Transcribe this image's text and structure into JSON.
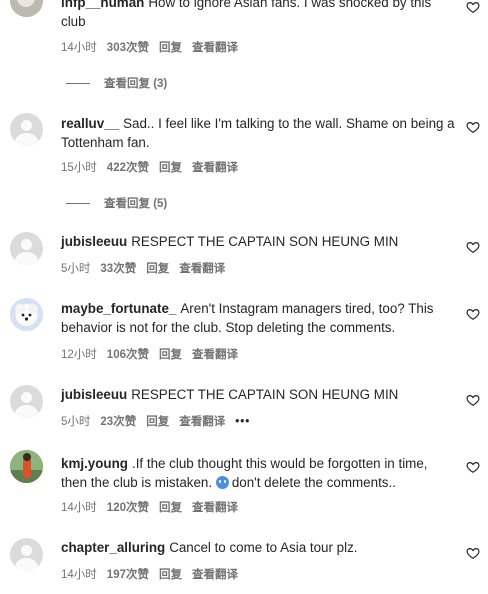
{
  "comments": [
    {
      "username": "infp__human",
      "text": "How to ignore Asian fans. I was shocked by this club",
      "time": "14小时",
      "likes": "303次赞",
      "reply": "回复",
      "translate": "查看翻译",
      "view_replies": "查看回复 (3)"
    },
    {
      "username": "realluv__",
      "text": "Sad.. I feel like I'm talking to the wall. Shame on being a Tottenham fan.",
      "time": "15小时",
      "likes": "422次赞",
      "reply": "回复",
      "translate": "查看翻译",
      "view_replies": "查看回复 (5)"
    },
    {
      "username": "jubisleeuu",
      "text": "RESPECT THE CAPTAIN SON HEUNG MIN",
      "time": "5小时",
      "likes": "33次赞",
      "reply": "回复",
      "translate": "查看翻译"
    },
    {
      "username": "maybe_fortunate_",
      "text": "Aren't Instagram managers tired, too? This behavior is not for the club. Stop deleting the comments.",
      "time": "12小时",
      "likes": "106次赞",
      "reply": "回复",
      "translate": "查看翻译"
    },
    {
      "username": "jubisleeuu",
      "text": "RESPECT THE CAPTAIN SON HEUNG MIN",
      "time": "5小时",
      "likes": "23次赞",
      "reply": "回复",
      "translate": "查看翻译",
      "more": "•••"
    },
    {
      "username": "kmj.young",
      "text_before_emoji": ".If the club thought this would be forgotten in time, then the club is mistaken.",
      "text_after_emoji": "don't delete the comments..",
      "time": "14小时",
      "likes": "120次赞",
      "reply": "回复",
      "translate": "查看翻译"
    },
    {
      "username": "chapter_alluring",
      "text": "Cancel to come to Asia tour plz.",
      "time": "14小时",
      "likes": "197次赞",
      "reply": "回复",
      "translate": "查看翻译"
    }
  ]
}
